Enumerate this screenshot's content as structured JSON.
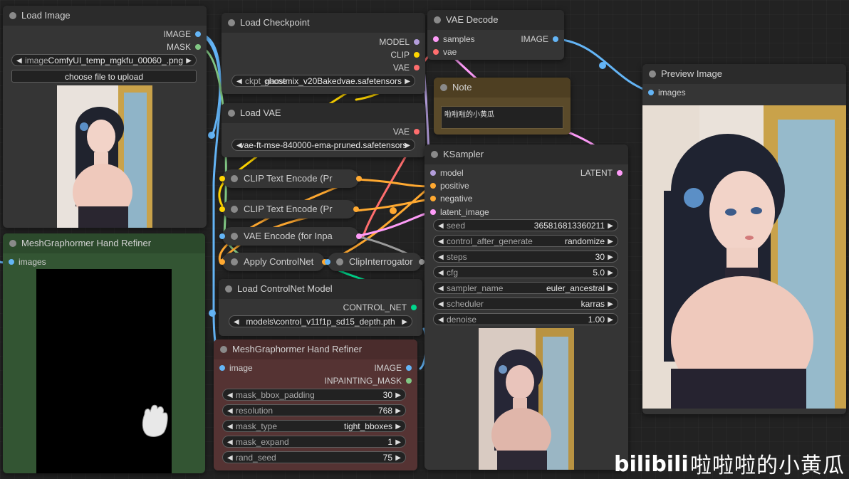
{
  "colors": {
    "image_port": "#64b5f6",
    "mask_port": "#81c784",
    "model_port": "#b39ddb",
    "clip_port": "#ffd500",
    "vae_port": "#ff6e6e",
    "conditioning_port": "#ffa931",
    "latent_port": "#ff9cf9",
    "controlnet_port": "#00d78d",
    "refiner_green": "#335533",
    "refiner_red": "#553333",
    "note_brown": "#5a4a2a"
  },
  "load_image": {
    "title": "Load Image",
    "outputs": [
      "IMAGE",
      "MASK"
    ],
    "image_label": "image",
    "image_value": "ComfyUI_temp_mgkfu_00060_.png",
    "upload_button": "choose file to upload"
  },
  "load_checkpoint": {
    "title": "Load Checkpoint",
    "outputs": [
      "MODEL",
      "CLIP",
      "VAE"
    ],
    "ckpt_label": "ckpt_name",
    "ckpt_value": "ghostmix_v20Bakedvae.safetensors"
  },
  "vae_decode": {
    "title": "VAE Decode",
    "inputs": [
      "samples",
      "vae"
    ],
    "outputs": [
      "IMAGE"
    ]
  },
  "note": {
    "title": "Note",
    "text": "啦啦啦的小黄瓜"
  },
  "preview_image": {
    "title": "Preview Image",
    "inputs": [
      "images"
    ]
  },
  "load_vae": {
    "title": "Load VAE",
    "outputs": [
      "VAE"
    ],
    "vae_label": "vae_name",
    "vae_value": "vae-ft-mse-840000-ema-pruned.safetensors"
  },
  "ksampler": {
    "title": "KSampler",
    "inputs": [
      "model",
      "positive",
      "negative",
      "latent_image"
    ],
    "outputs": [
      "LATENT"
    ],
    "widgets": [
      {
        "label": "seed",
        "value": "365816813360211"
      },
      {
        "label": "control_after_generate",
        "value": "randomize"
      },
      {
        "label": "steps",
        "value": "30"
      },
      {
        "label": "cfg",
        "value": "5.0"
      },
      {
        "label": "sampler_name",
        "value": "euler_ancestral"
      },
      {
        "label": "scheduler",
        "value": "karras"
      },
      {
        "label": "denoise",
        "value": "1.00"
      }
    ]
  },
  "collapsed_nodes": {
    "clip_text_encode_1": "CLIP Text Encode (Pr",
    "clip_text_encode_2": "CLIP Text Encode (Pr",
    "vae_encode_inpaint": "VAE Encode (for Inpa",
    "apply_controlnet": "Apply ControlNet",
    "clip_interrogator": "ClipInterrogator"
  },
  "load_controlnet": {
    "title": "Load ControlNet Model",
    "outputs": [
      "CONTROL_NET"
    ],
    "cn_label": "control_net_name",
    "cn_value": "models\\control_v11f1p_sd15_depth.pth"
  },
  "mesh_refiner_green": {
    "title": "MeshGraphormer Hand Refiner",
    "inputs": [
      "images"
    ]
  },
  "mesh_refiner_red": {
    "title": "MeshGraphormer Hand Refiner",
    "inputs": [
      "image"
    ],
    "outputs": [
      "IMAGE",
      "INPAINTING_MASK"
    ],
    "widgets": [
      {
        "label": "mask_bbox_padding",
        "value": "30"
      },
      {
        "label": "resolution",
        "value": "768"
      },
      {
        "label": "mask_type",
        "value": "tight_bboxes"
      },
      {
        "label": "mask_expand",
        "value": "1"
      },
      {
        "label": "rand_seed",
        "value": "75"
      }
    ]
  },
  "watermark": {
    "logo": "bilibili",
    "text": "啦啦啦的小黄瓜"
  }
}
